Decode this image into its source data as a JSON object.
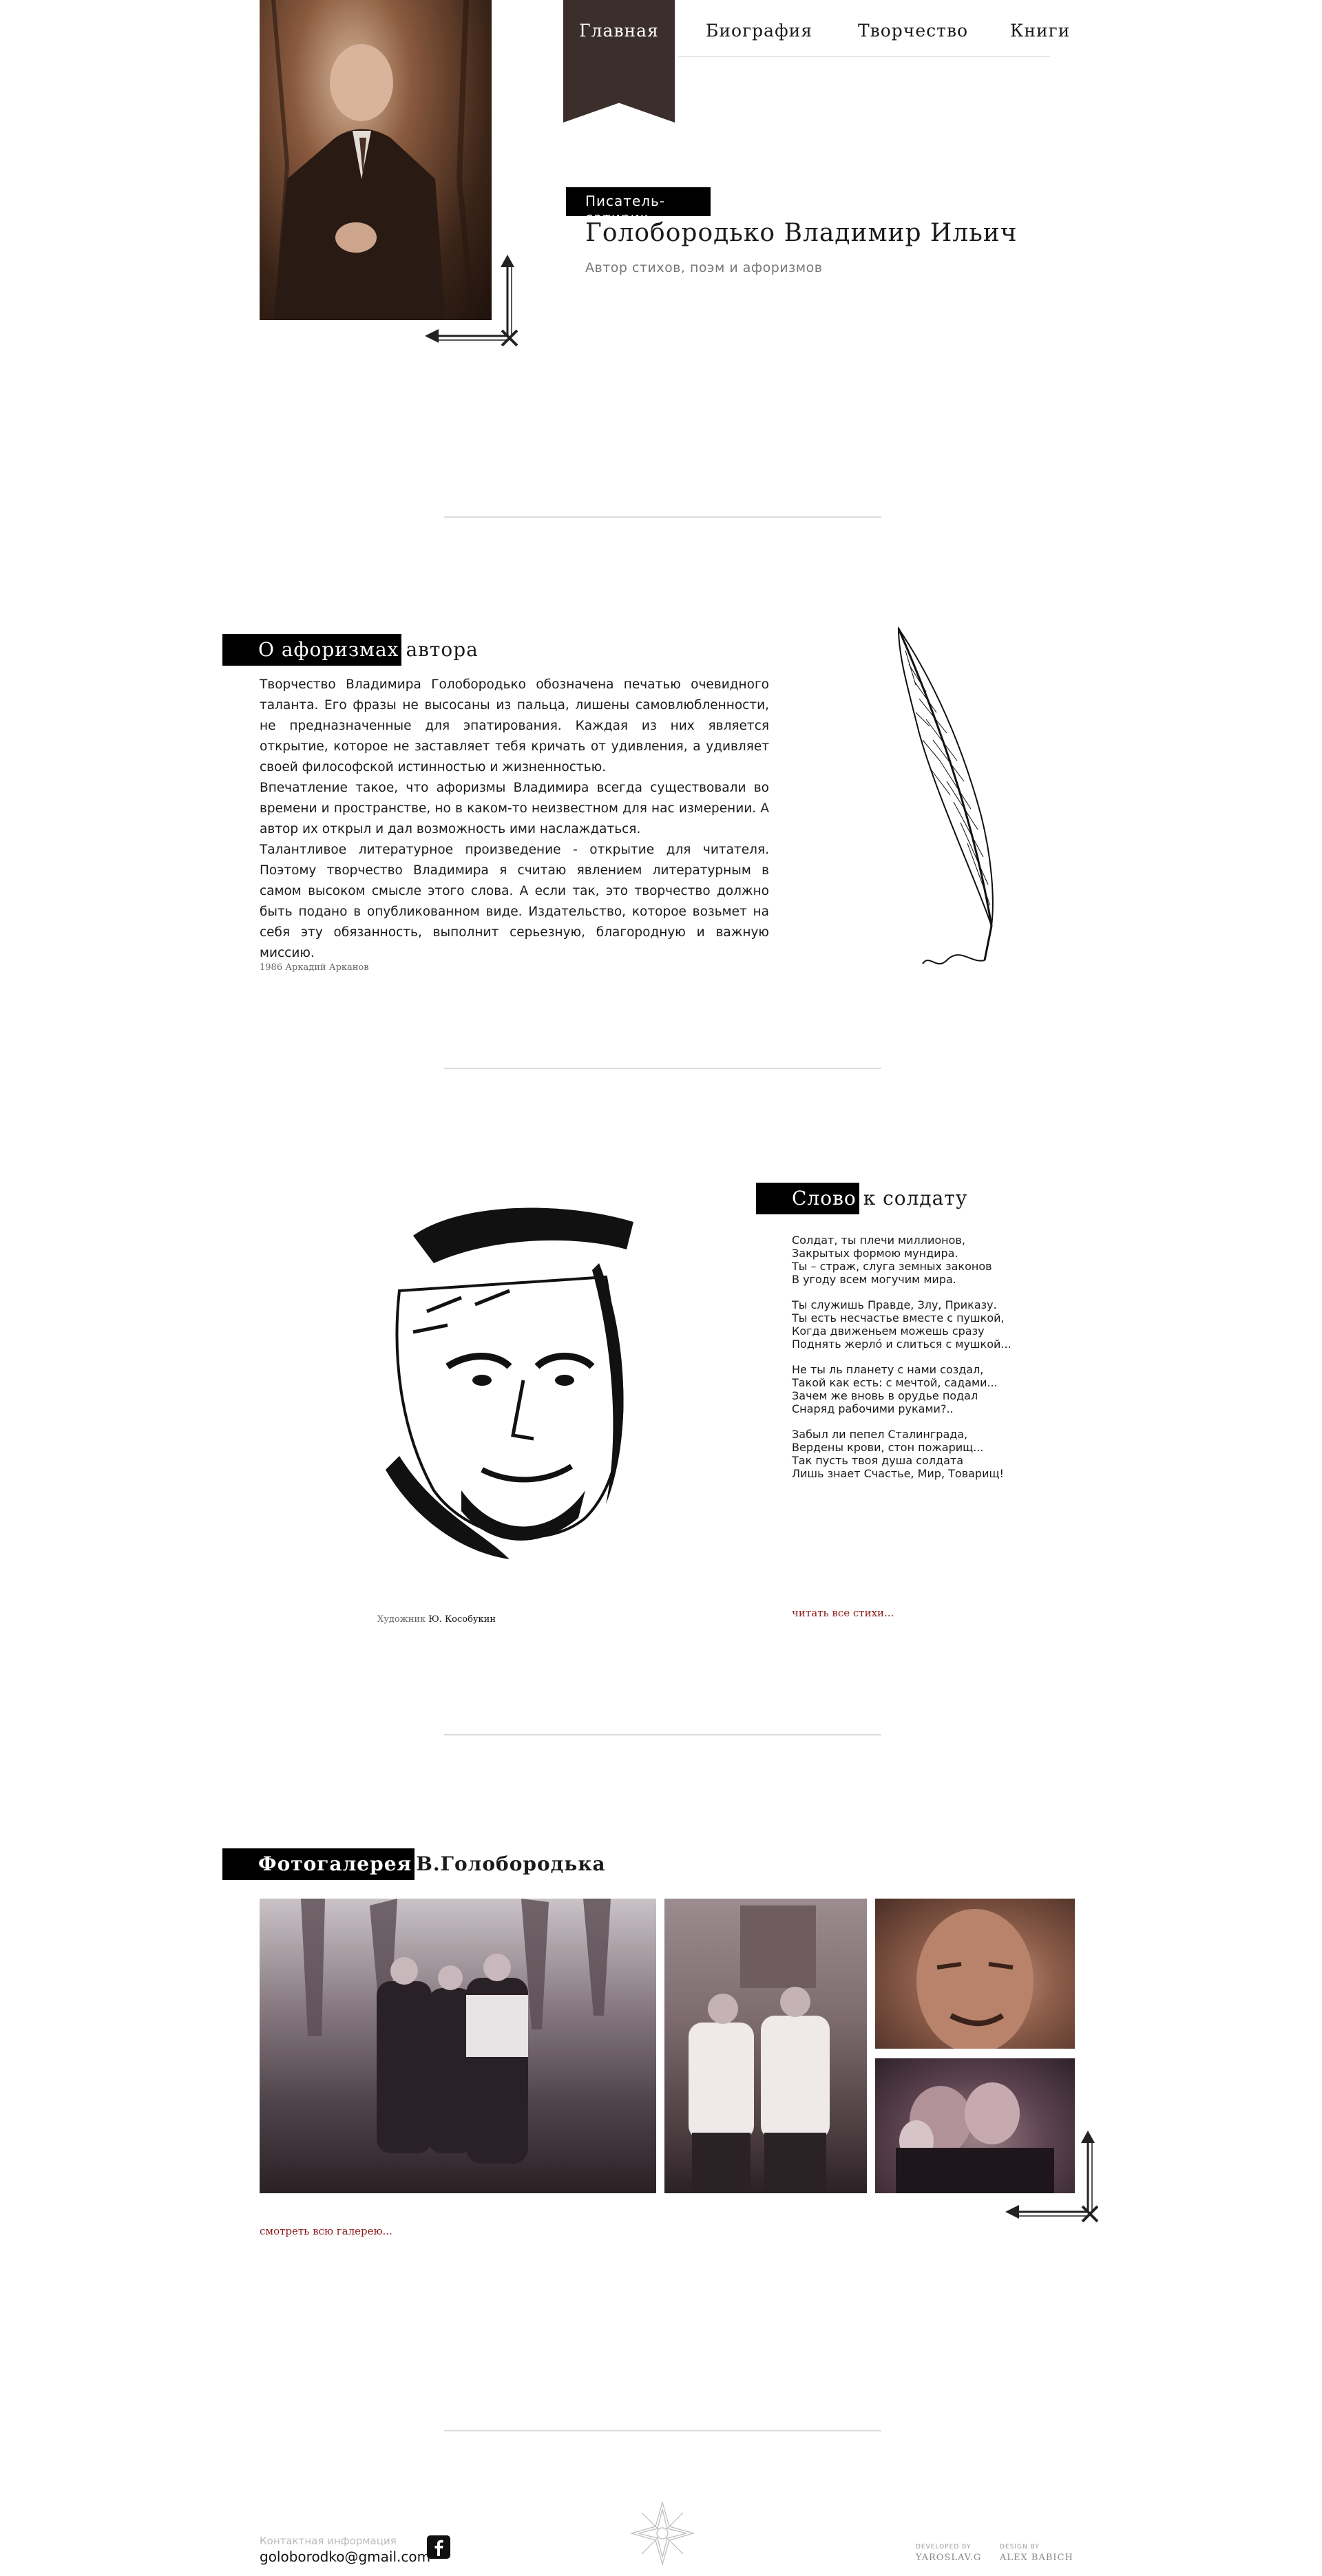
{
  "nav": {
    "items": [
      {
        "label": "Главная",
        "active": true
      },
      {
        "label": "Биография"
      },
      {
        "label": "Творчество"
      },
      {
        "label": "Книги"
      }
    ]
  },
  "header": {
    "tag": "Писатель-сатирик",
    "title": "Голобородько Владимир Ильич",
    "subtitle": "Автор стихов, поэм и афоризмов"
  },
  "aphorisms": {
    "heading_highlight": "О афоризмах",
    "heading_rest": "автора",
    "paragraphs": [
      "Творчество Владимира Голобородько обозначена печатью очевидного таланта. Его фразы не высосаны из пальца, лишены самовлюбленности, не предназначенные для эпатирования. Каждая из них является открытие, которое не заставляет тебя кричать от удивления, а удивляет своей философской истинностью и жизненностью.",
      "Впечатление такое, что афоризмы Владимира всегда существовали во времени и пространстве, но в каком-то неизвестном для нас измерении. А автор их открыл и дал возможность ими наслаждаться.",
      "Талантливое литературное произведение - открытие для читателя. Поэтому творчество Владимира я считаю явлением литературным в самом высоком смысле этого слова. А если так, это творчество должно быть подано в опубликованном виде. Издательство, которое возьмет на себя эту обязанность, выполнит серьезную, благородную и важную миссию."
    ],
    "signature": "1986 Аркадий Арканов"
  },
  "poem": {
    "heading_highlight": "Слово",
    "heading_rest": "к солдату",
    "stanzas": [
      {
        "lines": [
          "Солдат, ты плечи миллионов,",
          "Закрытых формою мундира.",
          "Ты – страж, слуга земных законов",
          "В угоду всем могучим мира."
        ]
      },
      {
        "lines": [
          "Ты служишь Правде, Злу, Приказу.",
          "Ты есть несчастье вместе с пушкой,",
          "Когда движеньем можешь сразу",
          "Поднять жерлó и слиться с мушкой..."
        ]
      },
      {
        "lines": [
          "Не ты ль планету с нами создал,",
          "Такой как есть: с мечтой, садами...",
          "Зачем же вновь в орудье подал",
          "Снаряд рабочими руками?.."
        ]
      },
      {
        "lines": [
          "Забыл ли пепел Сталинграда,",
          "Вердены крови, стон пожарищ...",
          "Так пусть твоя душа солдата",
          "Лишь знает Счастье, Мир, Товарищ!"
        ]
      }
    ],
    "read_all": "читать все стихи...",
    "artist_label": "Художник",
    "artist_name": "Ю. Кособукин"
  },
  "gallery": {
    "heading_highlight": "Фотогалерея",
    "heading_rest": "В.Голобородька",
    "see_all": "смотреть всю галерею..."
  },
  "footer": {
    "contact_label": "Контактная информация",
    "email": "goloborodko@gmail.com",
    "developed_label": "DEVELOPED BY",
    "developed_name": "YAROSLAV.G",
    "design_label": "DESIGN BY",
    "design_name": "ALEX BABICH"
  },
  "colors": {
    "nav_active_bg": "#3b2f2c",
    "accent_link": "#8b1a1a",
    "heading_block": "#000000"
  }
}
